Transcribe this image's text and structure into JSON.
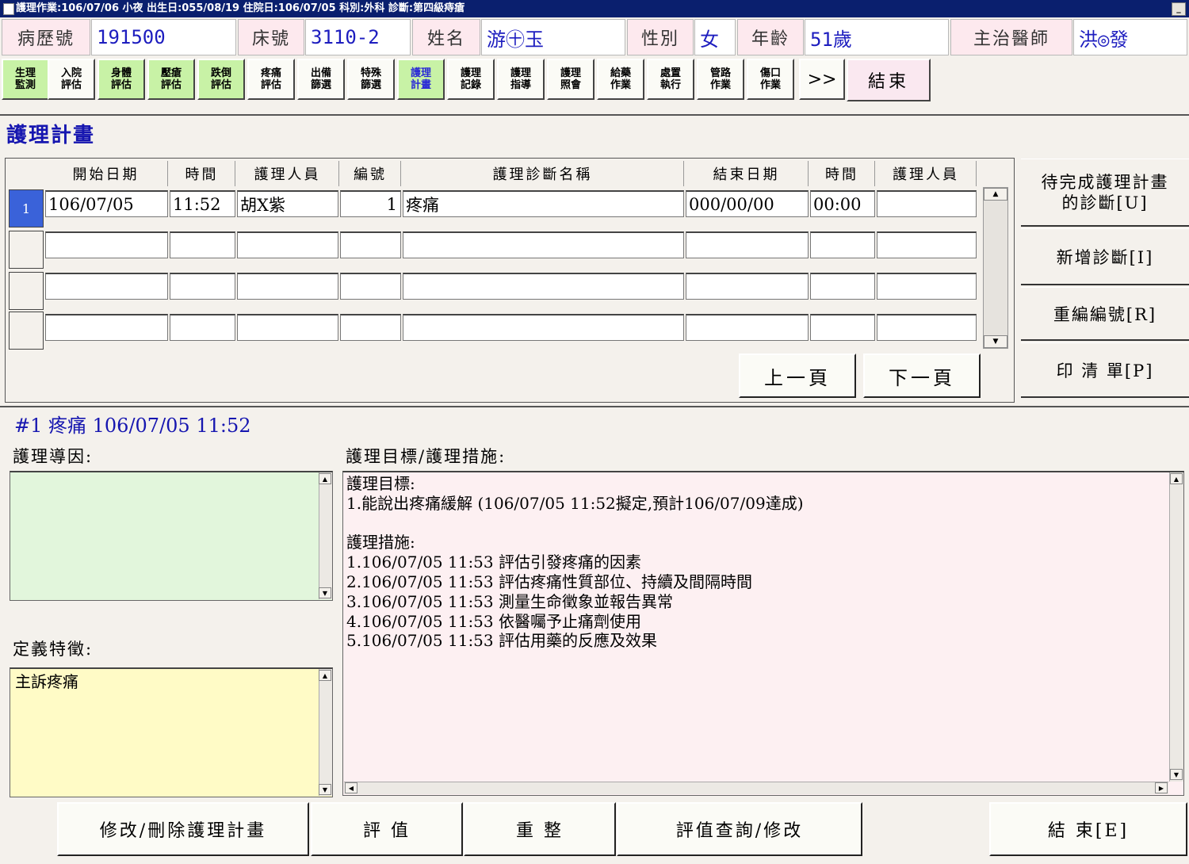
{
  "window": {
    "title": "護理作業:106/07/06 小夜    出生日:055/08/19 住院日:106/07/05 科別:外科 診斷:第四級痔瘡",
    "minimize_label": "_"
  },
  "patient": {
    "chart_no_label": "病歷號",
    "chart_no": "191500",
    "bed_label": "床號",
    "bed": "3110-2",
    "name_label": "姓名",
    "name": "游㊉玉",
    "sex_label": "性別",
    "sex": "女",
    "age_label": "年齡",
    "age": "51歲",
    "doctor_label": "主治醫師",
    "doctor": "洪◎發"
  },
  "toolbar": {
    "items": [
      {
        "label": "生理\n監測"
      },
      {
        "label": "入院\n評估"
      },
      {
        "label": "身體\n評估"
      },
      {
        "label": "壓瘡\n評估"
      },
      {
        "label": "跌倒\n評估"
      },
      {
        "label": "疼痛\n評估"
      },
      {
        "label": "出備\n篩選"
      },
      {
        "label": "特殊\n篩選"
      },
      {
        "label": "護理\n計畫"
      },
      {
        "label": "護理\n記錄"
      },
      {
        "label": "護理\n指導"
      },
      {
        "label": "護理\n照會"
      },
      {
        "label": "給藥\n作業"
      },
      {
        "label": "處置\n執行"
      },
      {
        "label": "管路\n作業"
      },
      {
        "label": "傷口\n作業"
      }
    ],
    "more_label": ">>",
    "end_label": "結束"
  },
  "section_title": "護理計畫",
  "grid": {
    "columns": [
      "開始日期",
      "時間",
      "護理人員",
      "編號",
      "護理診斷名稱",
      "結束日期",
      "時間",
      "護理人員"
    ],
    "rows": [
      {
        "row_no": "1",
        "start_date": "106/07/05",
        "start_time": "11:52",
        "nurse": "胡X紫",
        "no": "1",
        "diagnosis": "疼痛",
        "end_date": "000/00/00",
        "end_time": "00:00",
        "end_nurse": ""
      }
    ],
    "prev_page": "上一頁",
    "next_page": "下一頁"
  },
  "side_buttons": {
    "pending": "待完成護理計畫\n的診斷[U]",
    "add": "新增診斷[I]",
    "renumber": "重編編號[R]",
    "print": "印 清 單[P]"
  },
  "detail": {
    "header": "#1 疼痛 106/07/05 11:52",
    "reason_label": "護理導因:",
    "reason_text": "",
    "define_label": "定義特徵:",
    "define_text": "主訴疼痛",
    "goal_label": "護理目標/護理措施:",
    "goal_text": "護理目標:\n1.能說出疼痛緩解 (106/07/05 11:52擬定,預計106/07/09達成)\n\n護理措施:\n1.106/07/05 11:53 評估引發疼痛的因素\n2.106/07/05 11:53 評估疼痛性質部位、持續及間隔時間\n3.106/07/05 11:53 測量生命徵象並報告異常\n4.106/07/05 11:53 依醫囑予止痛劑使用\n5.106/07/05 11:53 評估用藥的反應及效果"
  },
  "bottom": {
    "modify": "修改/刪除護理計畫",
    "evaluate": "評 值",
    "reorganize": "重 整",
    "eval_query": "評值查詢/修改",
    "end": "結 束[E]"
  }
}
